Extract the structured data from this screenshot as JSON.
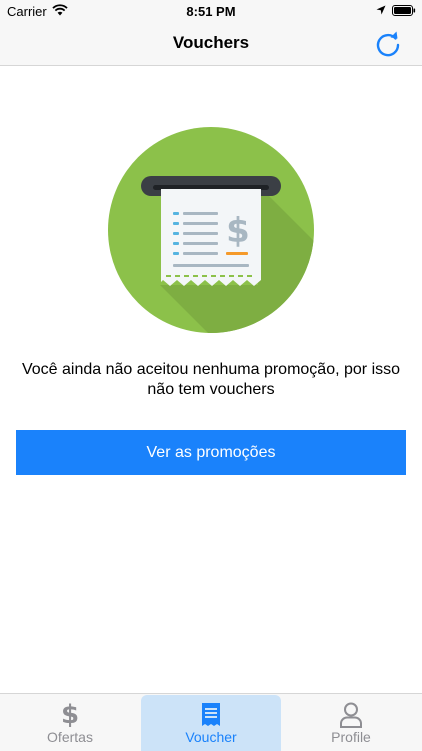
{
  "status_bar": {
    "carrier": "Carrier",
    "time": "8:51 PM"
  },
  "nav": {
    "title": "Vouchers",
    "refresh_icon": "refresh-icon"
  },
  "empty_state": {
    "message": "Você ainda não aceitou nenhuma promoção, por isso não tem vouchers",
    "button_label": "Ver as promoções",
    "illustration": "receipt-atm-illustration"
  },
  "tabs": [
    {
      "label": "Ofertas",
      "icon": "dollar-icon",
      "selected": false
    },
    {
      "label": "Voucher",
      "icon": "receipt-icon",
      "selected": true
    },
    {
      "label": "Profile",
      "icon": "person-icon",
      "selected": false
    }
  ],
  "colors": {
    "accent": "#1a82fb",
    "green": "#8cc14a",
    "selected_tab_bg": "#cce3f8"
  }
}
